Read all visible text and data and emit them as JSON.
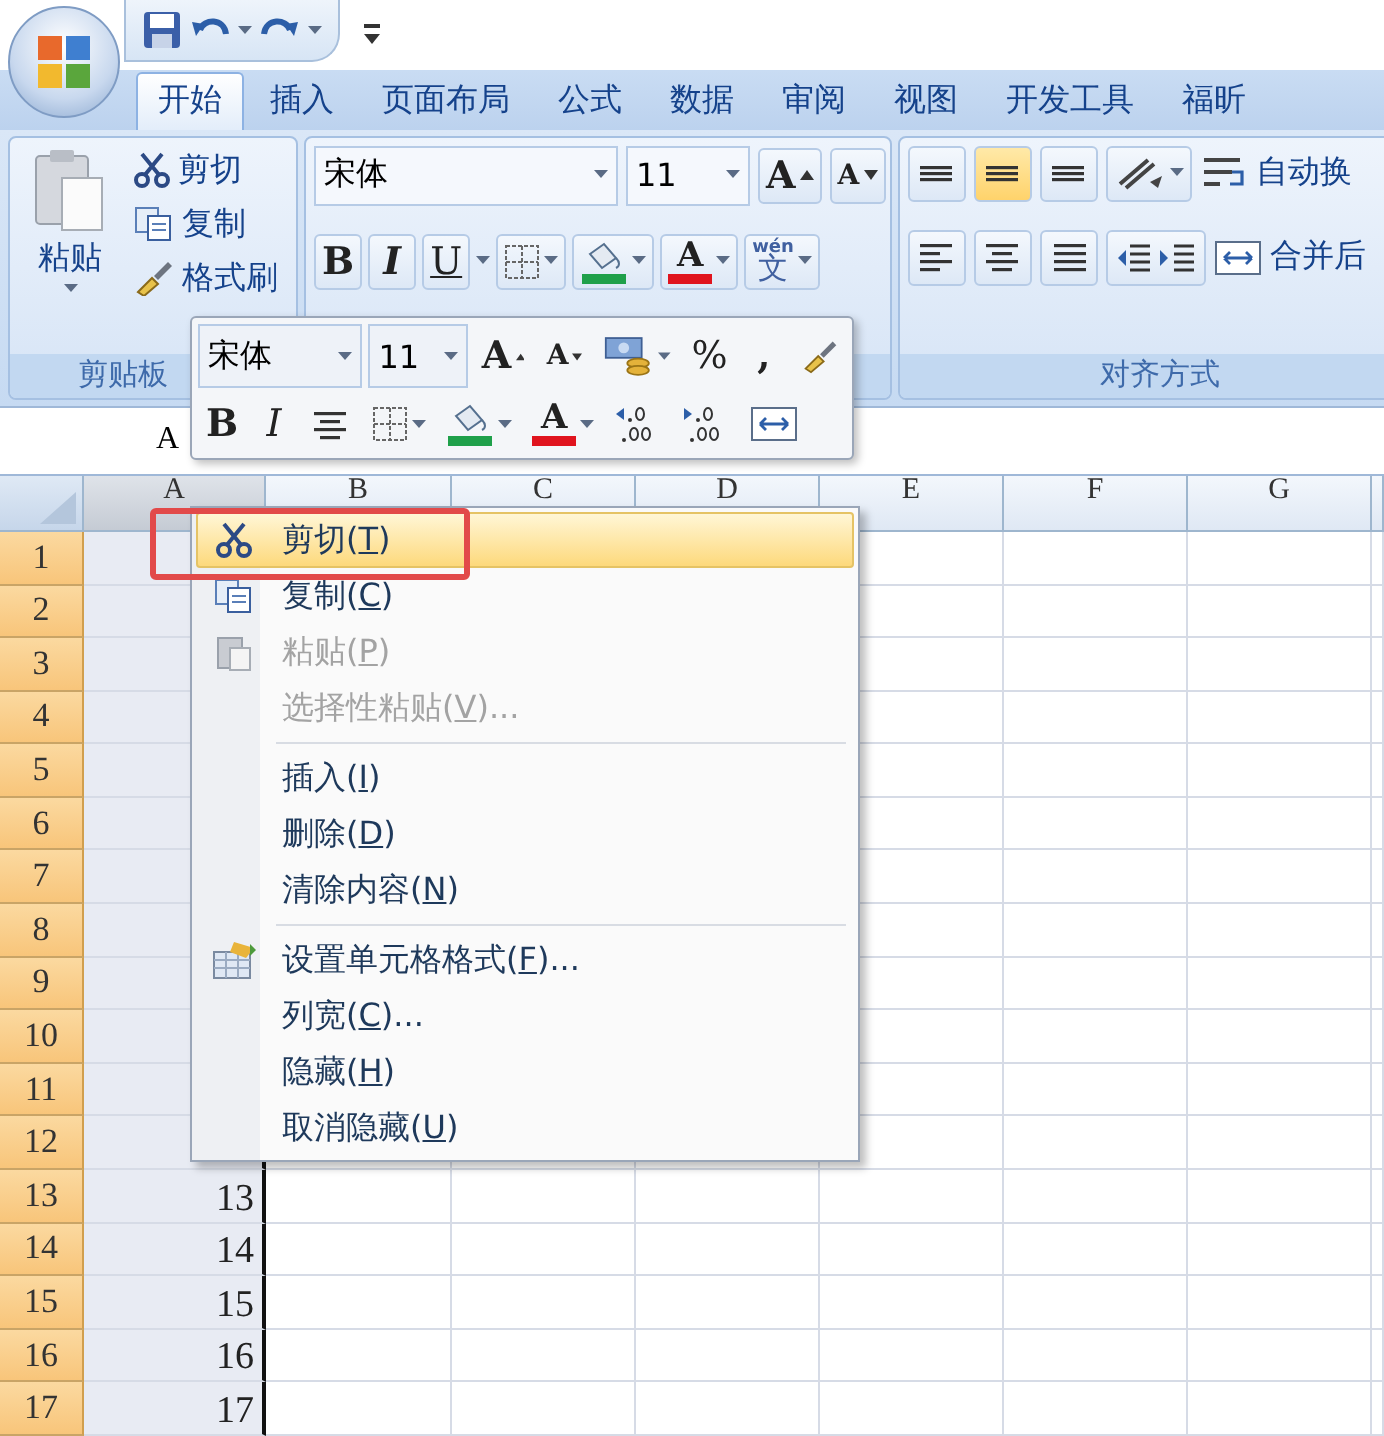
{
  "tabs": [
    {
      "label": "开始",
      "selected": true
    },
    {
      "label": "插入",
      "selected": false
    },
    {
      "label": "页面布局",
      "selected": false
    },
    {
      "label": "公式",
      "selected": false
    },
    {
      "label": "数据",
      "selected": false
    },
    {
      "label": "审阅",
      "selected": false
    },
    {
      "label": "视图",
      "selected": false
    },
    {
      "label": "开发工具",
      "selected": false
    },
    {
      "label": "福昕",
      "selected": false
    }
  ],
  "clipboard": {
    "title": "剪贴板",
    "paste": "粘贴",
    "commands": [
      {
        "kind": "cut",
        "label": "剪切"
      },
      {
        "kind": "copy",
        "label": "复制"
      },
      {
        "kind": "painter",
        "label": "格式刷"
      }
    ]
  },
  "font": {
    "font_name": "宋体",
    "font_size": "11",
    "grow": "A",
    "shrink": "A",
    "bold": "B",
    "italic": "I",
    "underline": "U",
    "font_color": "A",
    "phonetic_hint": "wén",
    "phonetic": "文"
  },
  "alignment": {
    "title": "对齐方式",
    "wrap_text": "自动换",
    "merge": "合并后"
  },
  "name_box": "A",
  "mini_toolbar": {
    "font_name": "宋体",
    "font_size": "11",
    "grow": "A",
    "shrink": "A",
    "percent": "%",
    "comma": ",",
    "bold": "B",
    "italic": "I",
    "font_color": "A"
  },
  "sheet": {
    "columns": [
      {
        "label": "A",
        "selected": true
      },
      {
        "label": "B",
        "selected": false
      },
      {
        "label": "C",
        "selected": false
      },
      {
        "label": "D",
        "selected": false
      },
      {
        "label": "E",
        "selected": false
      },
      {
        "label": "F",
        "selected": false
      },
      {
        "label": "G",
        "selected": false
      }
    ],
    "rows": [
      {
        "header": "1",
        "selected": true
      },
      {
        "header": "2",
        "selected": true
      },
      {
        "header": "3",
        "selected": true
      },
      {
        "header": "4",
        "selected": true
      },
      {
        "header": "5",
        "selected": true
      },
      {
        "header": "6",
        "selected": true
      },
      {
        "header": "7",
        "selected": true
      },
      {
        "header": "8",
        "selected": true
      },
      {
        "header": "9",
        "selected": true
      },
      {
        "header": "10",
        "selected": true
      },
      {
        "header": "11",
        "selected": true
      },
      {
        "header": "12",
        "selected": true
      },
      {
        "header": "13",
        "selected": true,
        "value": "13"
      },
      {
        "header": "14",
        "selected": true,
        "value": "14"
      },
      {
        "header": "15",
        "selected": true,
        "value": "15"
      },
      {
        "header": "16",
        "selected": true,
        "value": "16"
      },
      {
        "header": "17",
        "selected": true,
        "value": "17"
      }
    ]
  },
  "context_menu": {
    "items": [
      {
        "kind": "cut",
        "label": "剪切(T)",
        "selected": true,
        "disabled": false
      },
      {
        "kind": "copy",
        "label": "复制(C)",
        "selected": false,
        "disabled": false
      },
      {
        "kind": "paste",
        "label": "粘贴(P)",
        "selected": false,
        "disabled": true
      },
      {
        "kind": "command",
        "label": "选择性粘贴(V)...",
        "selected": false,
        "disabled": true
      },
      {
        "kind": "separator"
      },
      {
        "kind": "command",
        "label": "插入(I)",
        "selected": false,
        "disabled": false
      },
      {
        "kind": "command",
        "label": "删除(D)",
        "selected": false,
        "disabled": false
      },
      {
        "kind": "command",
        "label": "清除内容(N)",
        "selected": false,
        "disabled": false
      },
      {
        "kind": "separator"
      },
      {
        "kind": "format",
        "label": "设置单元格格式(F)...",
        "selected": false,
        "disabled": false
      },
      {
        "kind": "command",
        "label": "列宽(C)...",
        "selected": false,
        "disabled": false
      },
      {
        "kind": "command",
        "label": "隐藏(H)",
        "selected": false,
        "disabled": false
      },
      {
        "kind": "command",
        "label": "取消隐藏(U)",
        "selected": false,
        "disabled": false
      }
    ]
  }
}
